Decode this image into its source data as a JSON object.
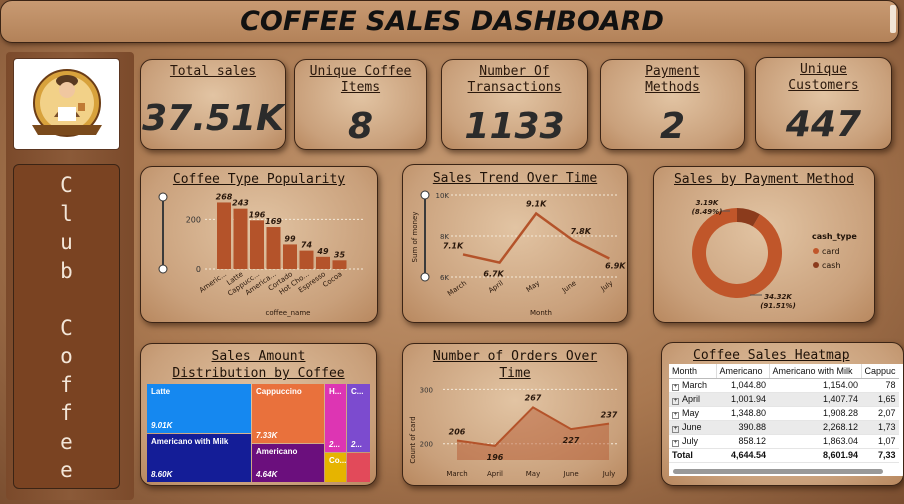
{
  "header": {
    "title": "COFFEE SALES DASHBOARD"
  },
  "sidebar": {
    "brand_letters": [
      "C",
      "l",
      "u",
      "b",
      "",
      "C",
      "o",
      "f",
      "f",
      "e",
      "e"
    ],
    "logo_icon": "barista-logo"
  },
  "kpis": [
    {
      "label": "Total sales",
      "value": "37.51K"
    },
    {
      "label": "Unique Coffee Items",
      "value": "8"
    },
    {
      "label": "Number Of Transactions",
      "value": "1133"
    },
    {
      "label": "Payment Methods",
      "value": "2"
    },
    {
      "label": "Unique Customers",
      "value": "447"
    }
  ],
  "popularity": {
    "title": "Coffee Type Popularity",
    "xlabel": "coffee_name",
    "yticks": [
      "200",
      "0"
    ],
    "labels": [
      "Americ...",
      "Latte",
      "Cappucc...",
      "America...",
      "Cortado",
      "Hot Cho...",
      "Espresso",
      "Cocoa"
    ]
  },
  "trend": {
    "title": "Sales Trend Over Time",
    "xlabel": "Month",
    "ylabel": "Sum of money",
    "yticks": [
      "10K",
      "8K",
      "6K"
    ],
    "labels": [
      "7.1K",
      "6.7K",
      "9.1K",
      "7.8K",
      "6.9K"
    ]
  },
  "payment": {
    "title": "Sales by Payment Method",
    "legend_title": "cash_type",
    "legend": [
      "card",
      "cash"
    ],
    "label_cash": "3.19K",
    "label_cash_pct": "(8.49%)",
    "label_card": "34.32K",
    "label_card_pct": "(91.51%)"
  },
  "treemap": {
    "title_line1": "Sales Amount",
    "title_line2": "Distribution by Coffee",
    "tiles": [
      {
        "name": "Latte",
        "value": "9.01K"
      },
      {
        "name": "Cappuccino",
        "value": "7.33K"
      },
      {
        "name": "H...",
        "value": "2..."
      },
      {
        "name": "C...",
        "value": "2..."
      },
      {
        "name": "Americano with Milk",
        "value": "8.60K"
      },
      {
        "name": "Americano",
        "value": "4.64K"
      },
      {
        "name": "Co...",
        "value": ""
      },
      {
        "name": "",
        "value": ""
      }
    ]
  },
  "orders": {
    "title_line1": "Number of Orders Over",
    "title_line2": "Time",
    "ylabel": "Count of card",
    "yticks": [
      "300",
      "200"
    ],
    "labels": [
      "206",
      "196",
      "267",
      "227",
      "237"
    ]
  },
  "heatmap": {
    "title": "Coffee Sales Heatmap",
    "columns": [
      "Month",
      "Americano",
      "Americano with Milk",
      "Cappuc"
    ],
    "rows": [
      {
        "month": "March",
        "c1": "1,044.80",
        "c2": "1,154.00",
        "c3": "78"
      },
      {
        "month": "April",
        "c1": "1,001.94",
        "c2": "1,407.74",
        "c3": "1,65"
      },
      {
        "month": "May",
        "c1": "1,348.80",
        "c2": "1,908.28",
        "c3": "2,07"
      },
      {
        "month": "June",
        "c1": "390.88",
        "c2": "2,268.12",
        "c3": "1,73"
      },
      {
        "month": "July",
        "c1": "858.12",
        "c2": "1,863.04",
        "c3": "1,07"
      }
    ],
    "total": {
      "label": "Total",
      "c1": "4,644.54",
      "c2": "8,601.94",
      "c3": "7,33"
    }
  },
  "chart_data": [
    {
      "type": "bar",
      "title": "Coffee Type Popularity",
      "xlabel": "coffee_name",
      "ylabel": "",
      "categories": [
        "Americano with Milk",
        "Latte",
        "Cappuccino",
        "Americano",
        "Cortado",
        "Hot Chocolate",
        "Espresso",
        "Cocoa"
      ],
      "values": [
        268,
        243,
        196,
        169,
        99,
        74,
        49,
        35
      ],
      "ylim": [
        0,
        290
      ],
      "color": "#b4532a"
    },
    {
      "type": "line",
      "title": "Sales Trend Over Time",
      "xlabel": "Month",
      "ylabel": "Sum of money",
      "x": [
        "March",
        "April",
        "May",
        "June",
        "July"
      ],
      "values": [
        7100,
        6700,
        9100,
        7800,
        6900
      ],
      "ylim": [
        6000,
        10000
      ],
      "color": "#b4532a"
    },
    {
      "type": "pie",
      "title": "Sales by Payment Method",
      "categories": [
        "card",
        "cash"
      ],
      "values": [
        34320,
        3190
      ],
      "colors": [
        "#c0562a",
        "#8b3b1c"
      ]
    },
    {
      "type": "area",
      "title": "Number of Orders Over Time",
      "xlabel": "",
      "ylabel": "Count of card",
      "x": [
        "March",
        "April",
        "May",
        "June",
        "July"
      ],
      "values": [
        206,
        196,
        267,
        227,
        237
      ],
      "ylim": [
        170,
        310
      ],
      "color": "#b4532a"
    }
  ]
}
